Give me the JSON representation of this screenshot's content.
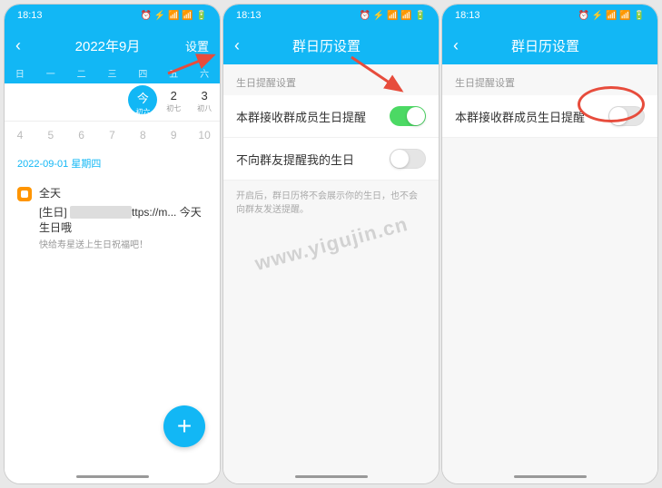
{
  "status": {
    "time": "18:13",
    "icons": "⏰ ⚡ 📶 📶 🔋"
  },
  "screen1": {
    "title": "2022年9月",
    "action": "设置",
    "weekdays": [
      "日",
      "一",
      "二",
      "三",
      "四",
      "五",
      "六"
    ],
    "todayLabel": "今",
    "todayLunar": "初六",
    "day2": "2",
    "day2Lunar": "初七",
    "day3": "3",
    "day3Lunar": "初八",
    "row2": [
      "4",
      "5",
      "6",
      "7",
      "8",
      "9",
      "10"
    ],
    "dateLabel": "2022-09-01  星期四",
    "allday": "全天",
    "eventTitle1": "[生日] ",
    "eventTitleBlur": "　　　",
    "eventTitle2": "ttps://m...  今天生日哦",
    "eventSub": "快给寿星送上生日祝福吧！"
  },
  "screen2": {
    "title": "群日历设置",
    "sectionLabel": "生日提醒设置",
    "row1": "本群接收群成员生日提醒",
    "row2": "不向群友提醒我的生日",
    "hint": "开启后，群日历将不会展示你的生日，也不会向群友发送提醒。"
  },
  "screen3": {
    "title": "群日历设置",
    "sectionLabel": "生日提醒设置",
    "row1": "本群接收群成员生日提醒"
  },
  "watermark": "www.yigujin.cn"
}
